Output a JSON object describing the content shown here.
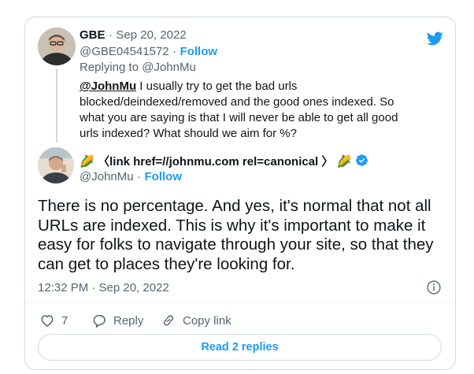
{
  "reply": {
    "name": "GBE",
    "separator": "·",
    "date": "Sep 20, 2022",
    "handle": "@GBE04541572",
    "follow_label": "Follow",
    "replying_prefix": "Replying to",
    "replying_handle": "@JohnMu",
    "mention": "@JohnMu",
    "body": "I usually try to get the bad urls blocked/deindexed/removed and the good ones indexed. So what you are saying is that I will never be able to get all good urls indexed? What should we aim for %?"
  },
  "tweet": {
    "name_emoji_left": "🌽",
    "name_text": "〈link href=//johnmu.com rel=canonical 〉",
    "name_emoji_right": "🌽",
    "handle": "@JohnMu",
    "follow_label": "Follow",
    "body": "There is no percentage. And yes, it's normal that not all URLs are indexed. This is why it's important to make it easy for folks to navigate through your site, so that they can get to places they're looking for.",
    "timestamp": "12:32 PM · Sep 20, 2022",
    "like_count": "7",
    "reply_label": "Reply",
    "copy_link_label": "Copy link",
    "read_replies_label": "Read 2 replies"
  },
  "icons": {
    "brand": "twitter-bird-icon",
    "verified": "verified-badge-icon",
    "info": "info-icon",
    "like": "heart-icon",
    "reply": "reply-bubble-icon",
    "copy": "link-icon"
  },
  "colors": {
    "accent": "#1d9bf0",
    "text": "#0f1419",
    "muted": "#536471",
    "border": "#cfd9de"
  }
}
